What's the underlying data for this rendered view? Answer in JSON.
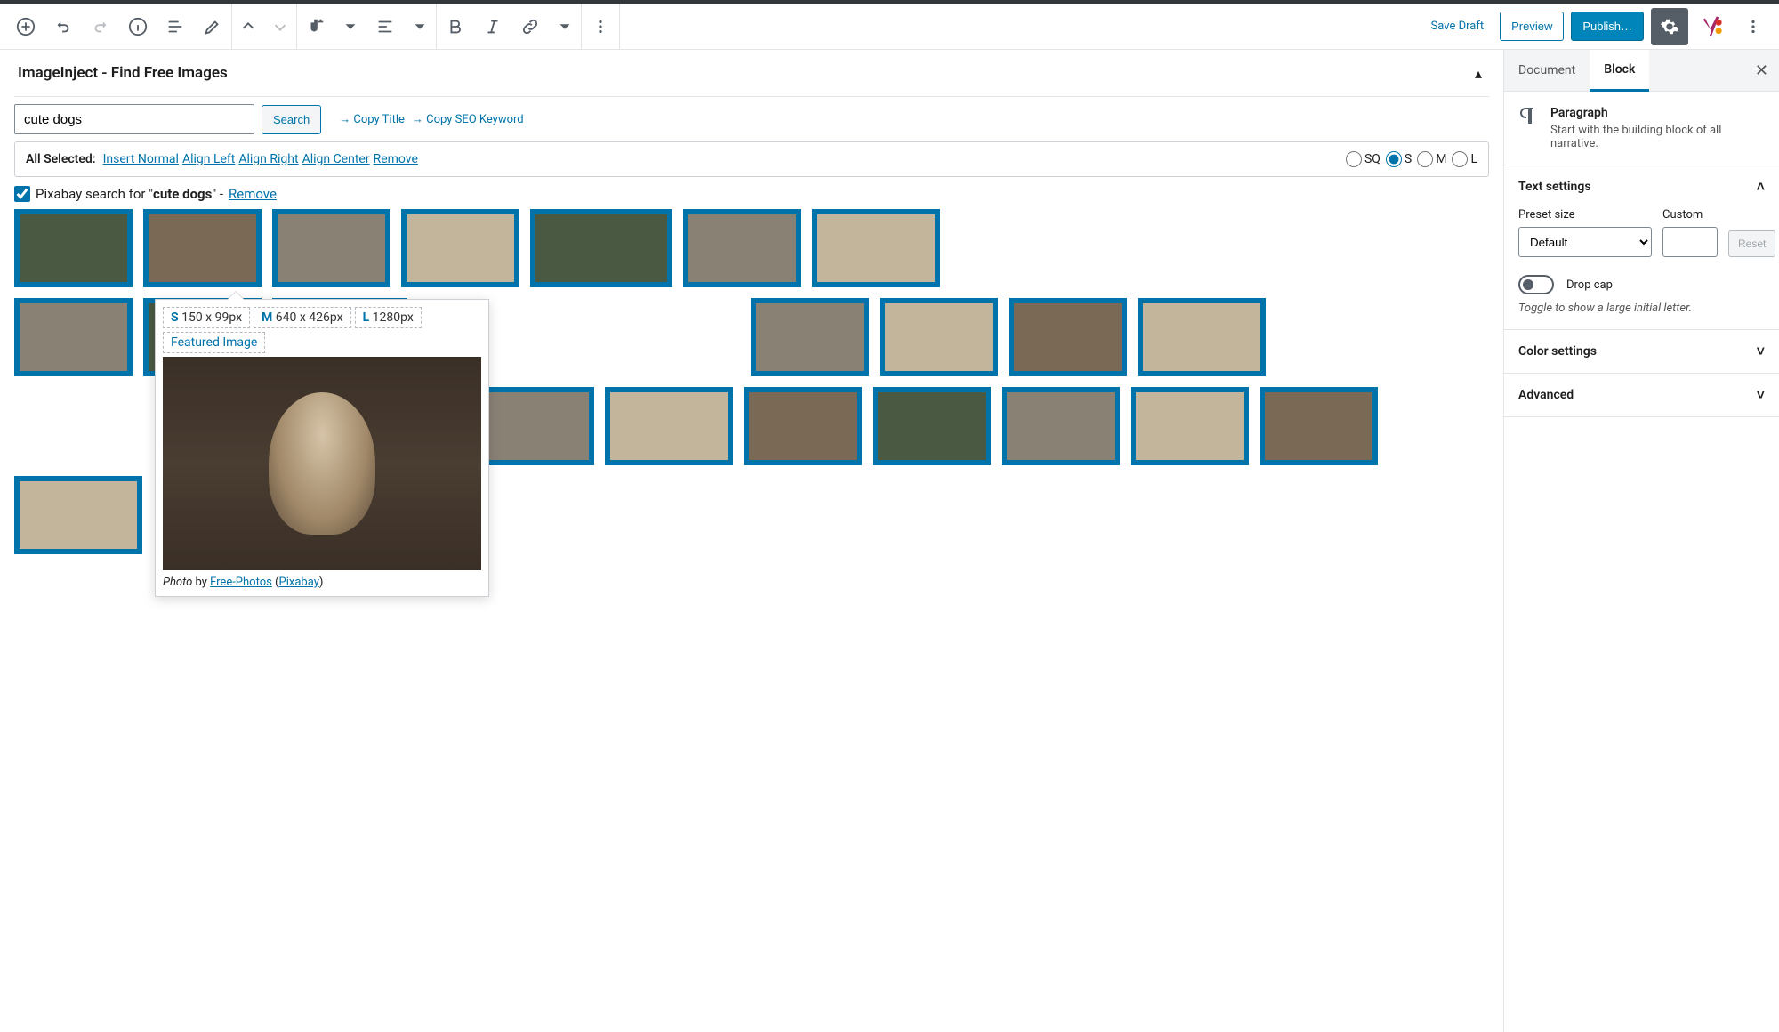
{
  "toolbar": {
    "save_draft": "Save Draft",
    "preview": "Preview",
    "publish": "Publish…"
  },
  "panel": {
    "title": "ImageInject - Find Free Images",
    "search_value": "cute dogs",
    "search_btn": "Search",
    "copy_title": "→ Copy Title",
    "copy_seo": "→ Copy SEO Keyword"
  },
  "selbar": {
    "label": "All Selected:",
    "insert_normal": "Insert Normal",
    "align_left": "Align Left",
    "align_right": "Align Right",
    "align_center": "Align Center",
    "remove": "Remove",
    "sizes": {
      "sq": "SQ",
      "s": "S",
      "m": "M",
      "l": "L"
    }
  },
  "source": {
    "prefix": "Pixabay search for \"",
    "term": "cute dogs",
    "suffix": "\" - ",
    "remove": "Remove"
  },
  "popover": {
    "s": {
      "label": "S",
      "dim": "150 x 99px"
    },
    "m": {
      "label": "M",
      "dim": "640 x 426px"
    },
    "l": {
      "label": "L",
      "dim": "1280px"
    },
    "featured": "Featured Image",
    "credit_photo": "Photo",
    "credit_by": " by ",
    "credit_author": "Free-Photos",
    "credit_source": "Pixabay"
  },
  "sidebar": {
    "tabs": {
      "document": "Document",
      "block": "Block"
    },
    "block": {
      "name": "Paragraph",
      "desc": "Start with the building block of all narrative."
    },
    "text_settings": {
      "title": "Text settings",
      "preset_label": "Preset size",
      "preset_value": "Default",
      "custom_label": "Custom",
      "reset": "Reset",
      "dropcap": "Drop cap",
      "dropcap_hint": "Toggle to show a large initial letter."
    },
    "color_settings": "Color settings",
    "advanced": "Advanced"
  }
}
